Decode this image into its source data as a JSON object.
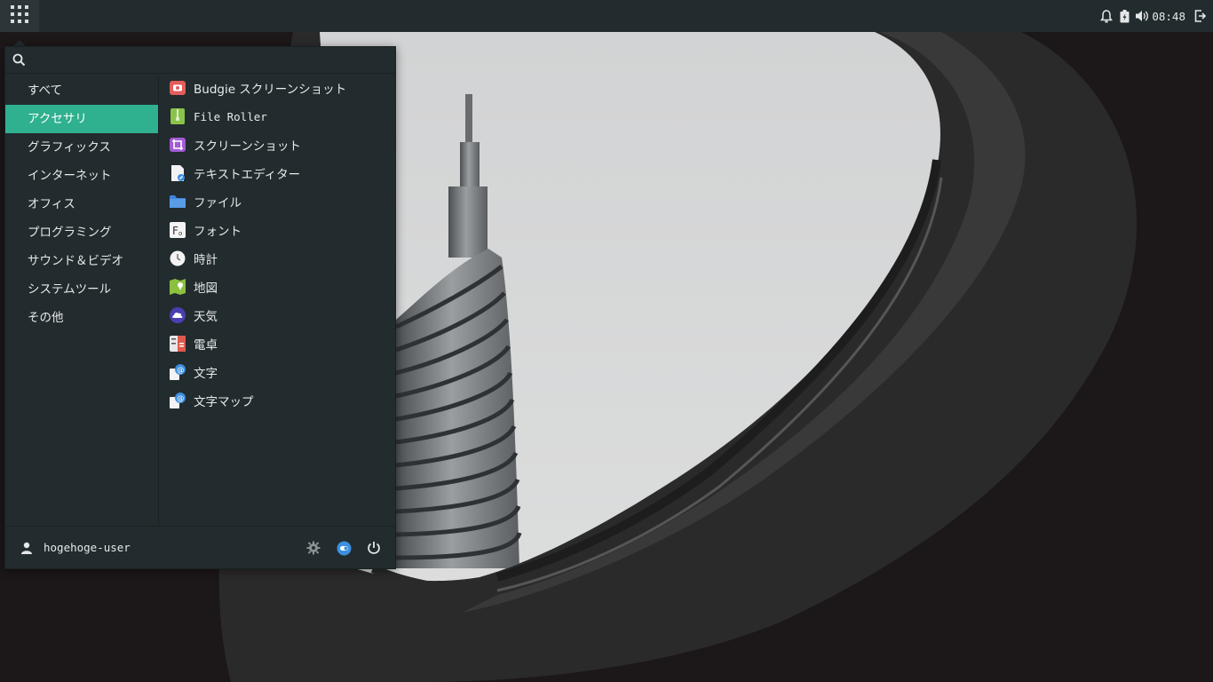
{
  "panel": {
    "menu_button_icon": "app-grid-icon",
    "tray_icons": [
      "bell-icon",
      "battery-icon",
      "volume-icon"
    ],
    "clock": "08:48",
    "logout_icon": "logout-icon"
  },
  "menu": {
    "search": {
      "placeholder": "",
      "value": ""
    },
    "categories": [
      {
        "label": "すべて",
        "active": false
      },
      {
        "label": "アクセサリ",
        "active": true
      },
      {
        "label": "グラフィックス",
        "active": false
      },
      {
        "label": "インターネット",
        "active": false
      },
      {
        "label": "オフィス",
        "active": false
      },
      {
        "label": "プログラミング",
        "active": false
      },
      {
        "label": "サウンド＆ビデオ",
        "active": false
      },
      {
        "label": "システムツール",
        "active": false
      },
      {
        "label": "その他",
        "active": false
      }
    ],
    "apps": [
      {
        "label": "Budgie スクリーンショット",
        "icon": "budgie-screenshot-icon"
      },
      {
        "label": "File Roller",
        "icon": "archive-icon"
      },
      {
        "label": "スクリーンショット",
        "icon": "screenshot-icon"
      },
      {
        "label": "テキストエディター",
        "icon": "text-editor-icon"
      },
      {
        "label": "ファイル",
        "icon": "folder-icon"
      },
      {
        "label": "フォント",
        "icon": "font-icon"
      },
      {
        "label": "時計",
        "icon": "clock-icon"
      },
      {
        "label": "地図",
        "icon": "map-icon"
      },
      {
        "label": "天気",
        "icon": "weather-icon"
      },
      {
        "label": "電卓",
        "icon": "calculator-icon"
      },
      {
        "label": "文字",
        "icon": "characters-icon"
      },
      {
        "label": "文字マップ",
        "icon": "character-map-icon"
      }
    ],
    "footer": {
      "user_name": "hogehoge-user",
      "buttons": [
        "settings-icon",
        "toggle-icon",
        "power-icon"
      ]
    }
  },
  "colors": {
    "panel_bg": "#222b2e",
    "menu_bg": "#222b2e",
    "accent": "#2fb08e",
    "text": "#e6eaea"
  }
}
